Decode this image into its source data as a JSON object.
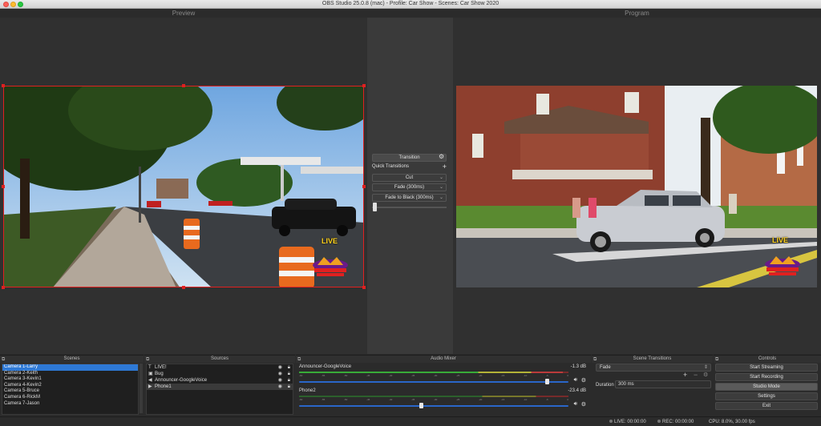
{
  "window": {
    "title": "OBS Studio 25.0.8 (mac) - Profile: Car Show - Scenes: Car Show 2020"
  },
  "panes": {
    "preview_label": "Preview",
    "program_label": "Program"
  },
  "overlay": {
    "live_text": "LIVE"
  },
  "transitions": {
    "button_label": "Transition",
    "quick_label": "Quick Transitions",
    "items": [
      "Cut",
      "Fade (300ms)",
      "Fade to Black (300ms)"
    ]
  },
  "scenes": {
    "title": "Scenes",
    "items": [
      "Camera 1-Larry",
      "Camera 2-Keith",
      "Camera 3-Kevin1",
      "Camera 4-Kevin2",
      "Camera 5-Bruce",
      "Camera 6-RickM",
      "Camera 7-Jason"
    ]
  },
  "sources": {
    "title": "Sources",
    "items": [
      {
        "label": "LIVE!",
        "icon": "text-icon"
      },
      {
        "label": "Bug",
        "icon": "image-icon"
      },
      {
        "label": "Announcer-GoogleVoice",
        "icon": "audio-icon"
      },
      {
        "label": "Phone1",
        "icon": "media-icon"
      }
    ]
  },
  "mixer": {
    "title": "Audio Mixer",
    "channels": [
      {
        "name": "Announcer-GoogleVoice",
        "db": "-1.3 dB",
        "level": 0.98,
        "volume": 0.92
      },
      {
        "name": "Phone2",
        "db": "-23.4 dB",
        "level": 0.0,
        "volume": 0.45
      }
    ],
    "ticks": [
      "-60",
      "-55",
      "-50",
      "-45",
      "-40",
      "-35",
      "-30",
      "-25",
      "-20",
      "-15",
      "-10",
      "-5",
      "0"
    ]
  },
  "scene_transitions": {
    "title": "Scene Transitions",
    "selected": "Fade",
    "duration_label": "Duration",
    "duration_value": "300 ms"
  },
  "controls": {
    "title": "Controls",
    "start_streaming": "Start Streaming",
    "start_recording": "Start Recording",
    "studio_mode": "Studio Mode",
    "settings": "Settings",
    "exit": "Exit"
  },
  "status": {
    "live": "LIVE: 00:00:00",
    "rec": "REC: 00:00:00",
    "cpu": "CPU: 8.0%, 30.00 fps"
  },
  "colors": {
    "selection": "#2e79d6",
    "preview_border": "#e02020",
    "live_yellow": "#ffd21a"
  }
}
